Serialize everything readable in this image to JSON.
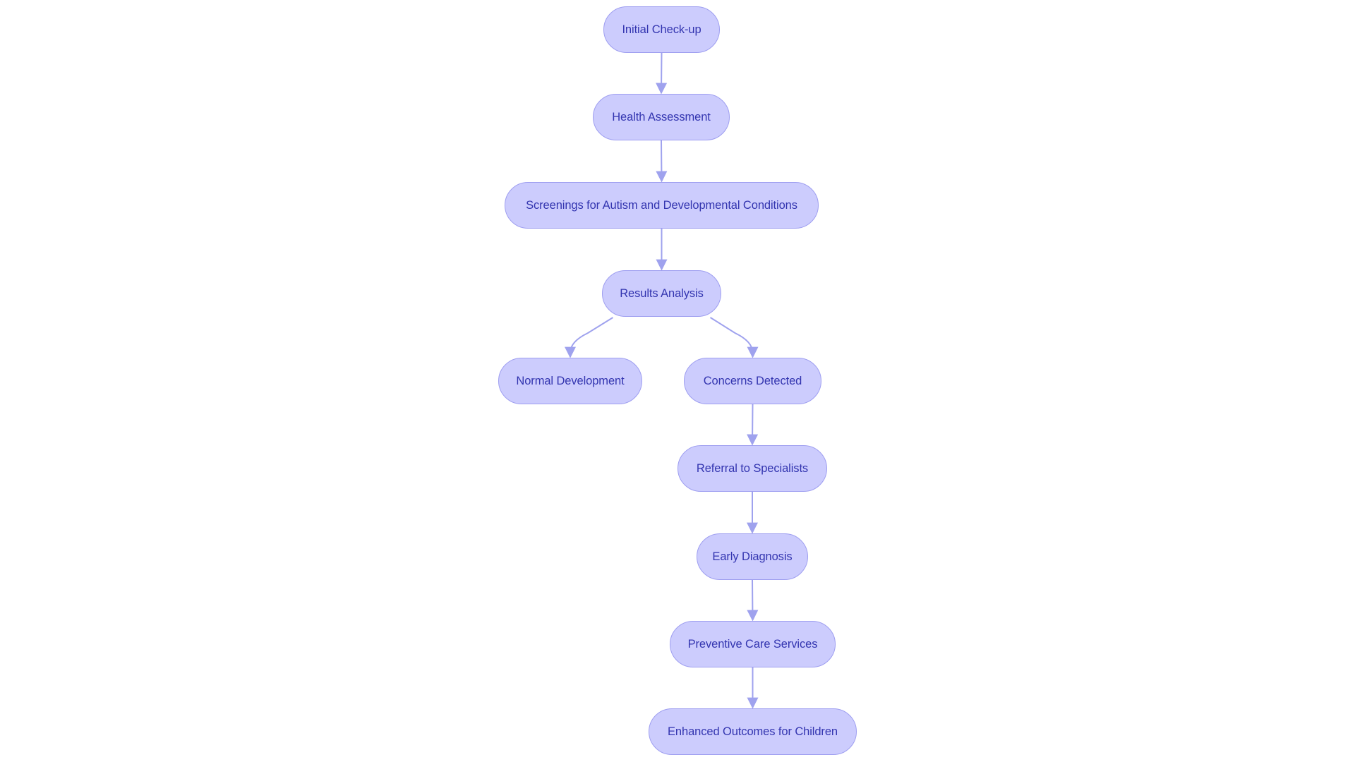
{
  "diagram": {
    "type": "flowchart",
    "direction": "top-down",
    "colors": {
      "node_fill": "#ccccfd",
      "node_border": "#9e9ef0",
      "node_text": "#3335b0",
      "edge": "#9fa2ee",
      "background": "#ffffff"
    },
    "nodes": [
      {
        "id": "initial",
        "label": "Initial Check-up"
      },
      {
        "id": "health",
        "label": "Health Assessment"
      },
      {
        "id": "screenings",
        "label": "Screenings for Autism and Developmental Conditions"
      },
      {
        "id": "results",
        "label": "Results Analysis"
      },
      {
        "id": "normal",
        "label": "Normal Development"
      },
      {
        "id": "concerns",
        "label": "Concerns Detected"
      },
      {
        "id": "referral",
        "label": "Referral to Specialists"
      },
      {
        "id": "early",
        "label": "Early Diagnosis"
      },
      {
        "id": "preventive",
        "label": "Preventive Care Services"
      },
      {
        "id": "enhanced",
        "label": "Enhanced Outcomes for Children"
      }
    ],
    "edges": [
      {
        "from": "initial",
        "to": "health"
      },
      {
        "from": "health",
        "to": "screenings"
      },
      {
        "from": "screenings",
        "to": "results"
      },
      {
        "from": "results",
        "to": "normal"
      },
      {
        "from": "results",
        "to": "concerns"
      },
      {
        "from": "concerns",
        "to": "referral"
      },
      {
        "from": "referral",
        "to": "early"
      },
      {
        "from": "early",
        "to": "preventive"
      },
      {
        "from": "preventive",
        "to": "enhanced"
      }
    ]
  }
}
